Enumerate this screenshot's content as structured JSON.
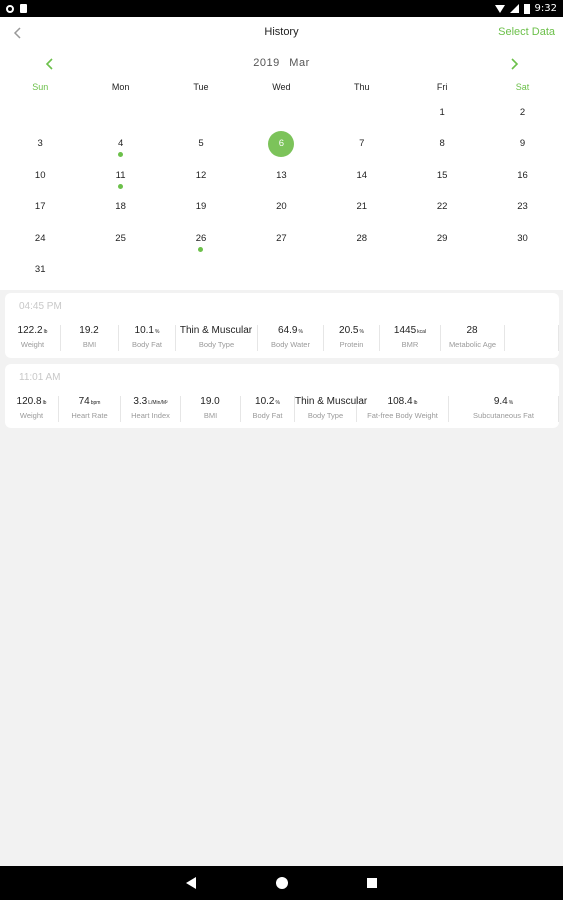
{
  "status_bar": {
    "time": "9:32"
  },
  "header": {
    "title": "History",
    "select_label": "Select Data"
  },
  "calendar": {
    "year": "2019",
    "month": "Mar",
    "weekdays": [
      "Sun",
      "Mon",
      "Tue",
      "Wed",
      "Thu",
      "Fri",
      "Sat"
    ],
    "weeks": [
      [
        "",
        "",
        "",
        "",
        "",
        "1",
        "2"
      ],
      [
        "3",
        "4",
        "5",
        "6",
        "7",
        "8",
        "9"
      ],
      [
        "10",
        "11",
        "12",
        "13",
        "14",
        "15",
        "16"
      ],
      [
        "17",
        "18",
        "19",
        "20",
        "21",
        "22",
        "23"
      ],
      [
        "24",
        "25",
        "26",
        "27",
        "28",
        "29",
        "30"
      ],
      [
        "31",
        "",
        "",
        "",
        "",
        "",
        ""
      ]
    ],
    "selected_day": "6",
    "days_with_data": [
      "4",
      "11",
      "26"
    ]
  },
  "records": [
    {
      "time": "04:45 PM",
      "metrics": [
        {
          "value": "122.2",
          "unit": "lb",
          "label": "Weight"
        },
        {
          "value": "19.2",
          "unit": "",
          "label": "BMI"
        },
        {
          "value": "10.1",
          "unit": "%",
          "label": "Body Fat"
        },
        {
          "value": "Thin & Muscular",
          "unit": "",
          "label": "Body Type"
        },
        {
          "value": "64.9",
          "unit": "%",
          "label": "Body Water"
        },
        {
          "value": "20.5",
          "unit": "%",
          "label": "Protein"
        },
        {
          "value": "1445",
          "unit": "kcal",
          "label": "BMR"
        },
        {
          "value": "28",
          "unit": "",
          "label": "Metabolic Age"
        },
        {
          "value": "",
          "unit": "",
          "label": ""
        }
      ]
    },
    {
      "time": "11:01 AM",
      "metrics": [
        {
          "value": "120.8",
          "unit": "lb",
          "label": "Weight"
        },
        {
          "value": "74",
          "unit": "bpm",
          "label": "Heart Rate"
        },
        {
          "value": "3.3",
          "unit": "L/Min/M²",
          "label": "Heart Index"
        },
        {
          "value": "19.0",
          "unit": "",
          "label": "BMI"
        },
        {
          "value": "10.2",
          "unit": "%",
          "label": "Body Fat"
        },
        {
          "value": "Thin & Muscular",
          "unit": "",
          "label": "Body Type"
        },
        {
          "value": "108.4",
          "unit": "lb",
          "label": "Fat-free Body Weight"
        },
        {
          "value": "9.4",
          "unit": "%",
          "label": "Subcutaneous Fat"
        }
      ]
    }
  ],
  "colors": {
    "accent": "#6cc04a",
    "selected": "#7cc35a",
    "muted_text": "#9a9a9a"
  }
}
